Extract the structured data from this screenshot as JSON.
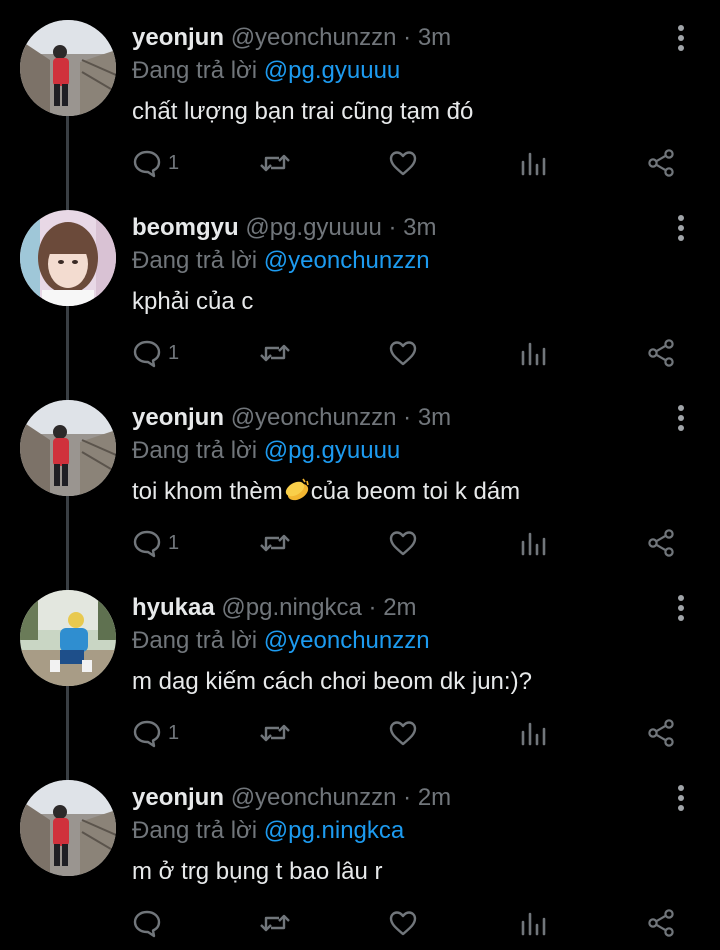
{
  "colors": {
    "background": "#000000",
    "text": "#e7e9ea",
    "muted": "#71767b",
    "mention": "#1d9bf0",
    "thread_line": "#3a3f44"
  },
  "labels": {
    "replying_to": "Đang trả lời",
    "separator": "·"
  },
  "icons": {
    "reply": "comment-bubble-icon",
    "retweet": "retweet-icon",
    "like": "heart-icon",
    "views": "bar-chart-icon",
    "share": "share-icon",
    "more": "more-vertical-icon",
    "emoji": "clapping-hands-emoji"
  },
  "tweets": [
    {
      "name": "yeonjun",
      "handle": "@yeonchunzzn",
      "time": "3m",
      "replying_to": "@pg.gyuuuu",
      "text": "chất lượng bạn trai cũng tạm đó",
      "reply_count": "1"
    },
    {
      "name": "beomgyu",
      "handle": "@pg.gyuuuu",
      "time": "3m",
      "replying_to": "@yeonchunzzn",
      "text": "kphải của c",
      "reply_count": "1"
    },
    {
      "name": "yeonjun",
      "handle": "@yeonchunzzn",
      "time": "3m",
      "replying_to": "@pg.gyuuuu",
      "text_before": "toi khom thèm",
      "text_after": "của beom toi k dám",
      "reply_count": "1"
    },
    {
      "name": "hyukaa",
      "handle": "@pg.ningkca",
      "time": "2m",
      "replying_to": "@yeonchunzzn",
      "text": "m dag kiếm cách chơi beom dk jun:)?",
      "reply_count": "1"
    },
    {
      "name": "yeonjun",
      "handle": "@yeonchunzzn",
      "time": "2m",
      "replying_to": "@pg.ningkca",
      "text": "m ở trg bụng t bao lâu r",
      "reply_count": ""
    }
  ]
}
